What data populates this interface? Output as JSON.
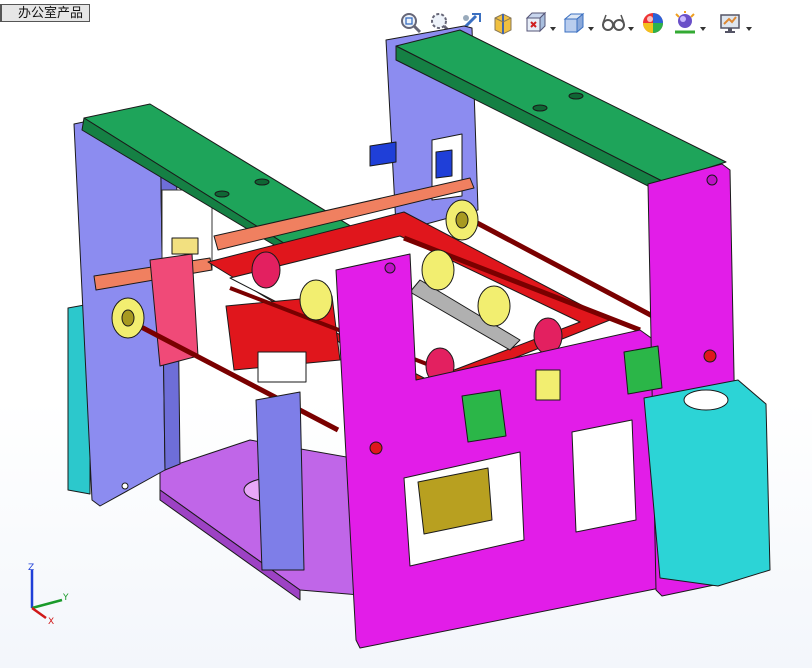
{
  "document_tab": {
    "label": "办公室产品"
  },
  "toolbar": {
    "items": [
      {
        "name": "zoom-to-fit-icon"
      },
      {
        "name": "zoom-to-area-icon"
      },
      {
        "name": "previous-view-icon"
      },
      {
        "name": "section-view-icon"
      },
      {
        "name": "view-orientation-icon"
      },
      {
        "name": "display-style-icon"
      },
      {
        "name": "hide-show-items-icon"
      },
      {
        "name": "edit-appearance-icon"
      },
      {
        "name": "apply-scene-icon"
      },
      {
        "name": "view-settings-icon"
      }
    ]
  },
  "triad": {
    "x_label": "X",
    "y_label": "Y",
    "z_label": "Z"
  },
  "colors": {
    "frame_green": "#1ea45a",
    "frame_magenta": "#e21de8",
    "frame_lavender": "#8c8cf0",
    "rail_red": "#e0161c",
    "roller_yellow": "#f2ee70",
    "cylinder_cyan": "#2cd4d6",
    "base_violet": "#c066e8",
    "part_pink": "#f04a78",
    "olive_block": "#b8a020"
  }
}
